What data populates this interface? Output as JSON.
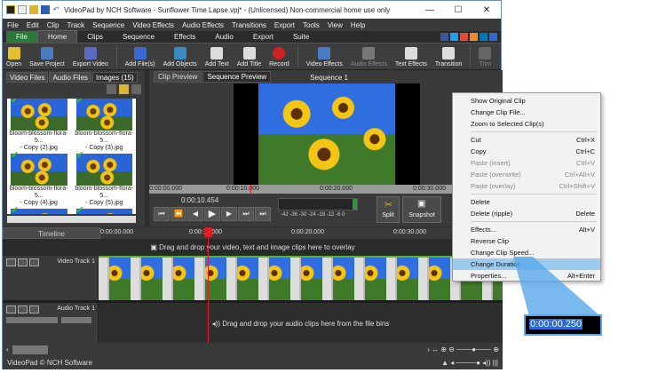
{
  "title": "VideoPad by NCH Software - Sunflower Time Lapse.vpj* - (Unlicensed) Non-commercial home use only",
  "window_controls": [
    "—",
    "☐",
    "✕"
  ],
  "menu": [
    "File",
    "Edit",
    "Clip",
    "Track",
    "Sequence",
    "Video Effects",
    "Audio Effects",
    "Transitions",
    "Export",
    "Tools",
    "View",
    "Help"
  ],
  "tabs": [
    "File",
    "Home",
    "Clips",
    "Sequence",
    "Effects",
    "Audio",
    "Export",
    "Suite"
  ],
  "toolbar": [
    "Open",
    "Save Project",
    "Export Video",
    "Add File(s)",
    "Add Objects",
    "Add Text",
    "Add Title",
    "Record",
    "Video Effects",
    "Audio Effects",
    "Text Effects",
    "Transition",
    "Trim"
  ],
  "bin": {
    "tabs": [
      "Video Files",
      "Audio Files",
      "Images (15)"
    ],
    "items": [
      {
        "l1": "bloom-blossom-flora-5...",
        "l2": "- Copy (2).jpg"
      },
      {
        "l1": "bloom-blossom-flora-5...",
        "l2": "- Copy (3).jpg"
      },
      {
        "l1": "bloom-blossom-flora-5...",
        "l2": "- Copy (4).jpg"
      },
      {
        "l1": "bloom-blossom-flora-5...",
        "l2": "- Copy (5).jpg"
      },
      {
        "l1": "",
        "l2": ""
      }
    ]
  },
  "preview": {
    "tabs": [
      "Clip Preview",
      "Sequence Preview"
    ],
    "sequence": "Sequence 1",
    "ruler": [
      "0:00:00.000",
      "0:00:10.000",
      "0:00:20.000",
      "0:00:30.000"
    ],
    "time": "0:00:10.454",
    "meter_labels": "-42 -36 -30 -24 -18 -12 -6 0",
    "split": "Split",
    "snapshot": "Snapshot",
    "transport": [
      "⏮",
      "⏪",
      "◀",
      "▶",
      "▶",
      "⏭",
      "⏭"
    ]
  },
  "timeline": {
    "label": "Timeline",
    "ruler": [
      "0:00:00.000",
      "0:00:10.000",
      "0:00:20.000",
      "0:00:30.000"
    ],
    "overlay_hint": "Drag and drop your video, text and image clips here to overlay",
    "video_track": "Video Track 1",
    "audio_track": "Audio Track 1",
    "audio_hint": "Drag and drop your audio clips here from the file bins"
  },
  "status": "VideoPad © NCH Software",
  "context_menu": [
    {
      "label": "Show Original Clip",
      "key": ""
    },
    {
      "label": "Change Clip File...",
      "key": ""
    },
    {
      "label": "Zoom to Selected Clip(s)",
      "key": ""
    },
    {
      "sep": true
    },
    {
      "label": "Cut",
      "key": "Ctrl+X"
    },
    {
      "label": "Copy",
      "key": "Ctrl+C"
    },
    {
      "label": "Paste (insert)",
      "key": "Ctrl+V",
      "disabled": true
    },
    {
      "label": "Paste (overwrite)",
      "key": "Ctrl+Alt+V",
      "disabled": true
    },
    {
      "label": "Paste (overlay)",
      "key": "Ctrl+Shift+V",
      "disabled": true
    },
    {
      "sep": true
    },
    {
      "label": "Delete",
      "key": ""
    },
    {
      "label": "Delete (ripple)",
      "key": "Delete"
    },
    {
      "sep": true
    },
    {
      "label": "Effects...",
      "key": "Alt+V"
    },
    {
      "label": "Reverse Clip",
      "key": ""
    },
    {
      "label": "Change Clip Speed...",
      "key": ""
    },
    {
      "label": "Change Duration",
      "key": "",
      "highlight": true
    },
    {
      "label": "Properties...",
      "key": "Alt+Enter"
    }
  ],
  "callout": "0:00:00.250",
  "colors": {
    "highlight": "#9ccbf0",
    "file_tab": "#2a7a3a",
    "playhead": "#e02020",
    "callout_border": "#58a8e8"
  }
}
